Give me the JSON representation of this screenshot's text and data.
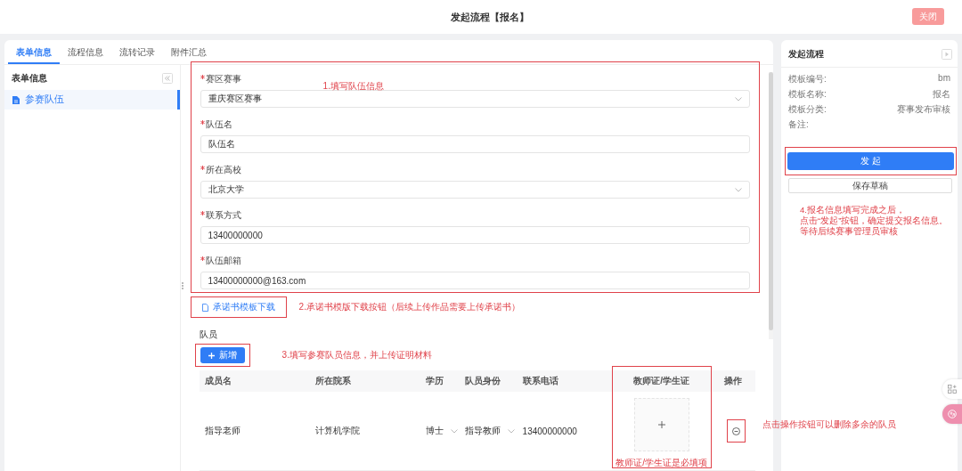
{
  "header": {
    "title": "发起流程【报名】",
    "close_button": "关闭"
  },
  "tabs": [
    {
      "label": "表单信息",
      "selected": true
    },
    {
      "label": "流程信息",
      "selected": false
    },
    {
      "label": "流转记录",
      "selected": false
    },
    {
      "label": "附件汇总",
      "selected": false
    }
  ],
  "sidebar": {
    "title": "表单信息",
    "items": [
      {
        "label": "参赛队伍",
        "selected": true
      }
    ]
  },
  "form": {
    "note": "1.填写队伍信息",
    "fields": [
      {
        "label": "赛区赛事",
        "required": true,
        "kind": "select",
        "value": "重庆赛区赛事"
      },
      {
        "label": "队伍名",
        "required": true,
        "kind": "text",
        "value": "队伍名"
      },
      {
        "label": "所在高校",
        "required": true,
        "kind": "select",
        "value": "北京大学"
      },
      {
        "label": "联系方式",
        "required": true,
        "kind": "text",
        "value": "13400000000"
      },
      {
        "label": "队伍邮箱",
        "required": true,
        "kind": "text",
        "value": "13400000000@163.com"
      }
    ]
  },
  "download": {
    "button": "承诺书模板下载",
    "note": "2.承诺书模版下载按钮（后续上传作品需要上传承诺书）"
  },
  "members": {
    "title": "队员",
    "add_button": "新增",
    "note": "3.填写参赛队员信息，并上传证明材料",
    "action_note": "点击操作按钮可以删除多余的队员",
    "columns": [
      "成员名",
      "所在院系",
      "学历",
      "队员身份",
      "联系电话",
      "教师证/学生证",
      "操作"
    ],
    "rows": [
      {
        "name": "指导老师",
        "department": "计算机学院",
        "degree": "博士",
        "role": "指导教师",
        "phone": "13400000000",
        "upload_hint": "教师证/学生证是必填项"
      }
    ]
  },
  "panel": {
    "title": "发起流程",
    "info": [
      {
        "label": "模板编号:",
        "value": "bm"
      },
      {
        "label": "模板名称:",
        "value": "报名"
      },
      {
        "label": "模板分类:",
        "value": "赛事发布审核"
      },
      {
        "label": "备注:"
      }
    ],
    "submit_button": "发 起",
    "draft_button": "保存草稿",
    "note": [
      "4.报名信息填写完成之后，",
      "点击“发起”按钮，确定提交报名信息。",
      "等待后续赛事管理员审核"
    ]
  }
}
